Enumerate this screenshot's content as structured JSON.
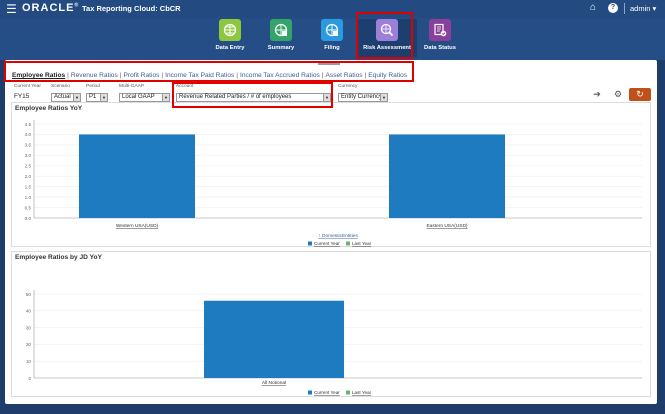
{
  "app": {
    "logo": "ORACLE",
    "logo_tm": "®",
    "title": "Tax Reporting Cloud: CbCR",
    "user": "admin ▾"
  },
  "nav": [
    {
      "label": "Data Entry",
      "icon": "data-entry-icon",
      "color": "#8dc63f"
    },
    {
      "label": "Summary",
      "icon": "summary-icon",
      "color": "#35a46a"
    },
    {
      "label": "Filing",
      "icon": "filing-icon",
      "color": "#2a9be0"
    },
    {
      "label": "Risk Assessment",
      "icon": "risk-assessment-icon",
      "color": "#9b7fd8",
      "active": true
    },
    {
      "label": "Data Status",
      "icon": "data-status-icon",
      "color": "#8a3f9c"
    }
  ],
  "tabs": [
    "Employee Ratios",
    "Revenue Ratios",
    "Profit Ratios",
    "Income Tax Paid Ratios",
    "Income Tax Accrued Ratios",
    "Asset Ratios",
    "Equity Ratios"
  ],
  "pov": {
    "current_year_label": "Current Year",
    "current_year_value": "FY15",
    "scenario_label": "Scenario",
    "scenario_value": "Actual",
    "period_label": "Period",
    "period_value": "P1",
    "multigaap_label": "Multi-GAAP",
    "multigaap_value": "Local GAAP",
    "account_label": "Account",
    "account_value": "Revenue Related Parties / # of employees",
    "currency_label": "Currency",
    "currency_value": "Entity Currency"
  },
  "chart_data": [
    {
      "type": "bar",
      "title": "Employee Ratios YoY",
      "categories": [
        "Western USA(USD)",
        "Eastern USA(USD)"
      ],
      "series": [
        {
          "name": "Current Year",
          "values": [
            4.0,
            4.0
          ],
          "color": "#1f7bbf"
        },
        {
          "name": "Last Year",
          "values": [
            0,
            0
          ],
          "color": "#6fb36b"
        }
      ],
      "yticks": [
        "0.0",
        "0.5",
        "1.0",
        "1.5",
        "2.0",
        "2.5",
        "3.0",
        "3.5",
        "4.0",
        "4.5"
      ],
      "ylim": [
        0,
        4.5
      ],
      "subnote": "DomesticEntities",
      "legend": "bottom"
    },
    {
      "type": "bar",
      "title": "Employee Ratios by JD YoY",
      "categories": [
        "All Notional"
      ],
      "series": [
        {
          "name": "Current Year",
          "values": [
            46
          ],
          "color": "#1f7bbf"
        },
        {
          "name": "Last Year",
          "values": [
            0
          ],
          "color": "#6fb36b"
        }
      ],
      "yticks": [
        "0",
        "10",
        "20",
        "30",
        "40",
        "50"
      ],
      "ylim": [
        0,
        50
      ],
      "legend": "bottom"
    }
  ]
}
